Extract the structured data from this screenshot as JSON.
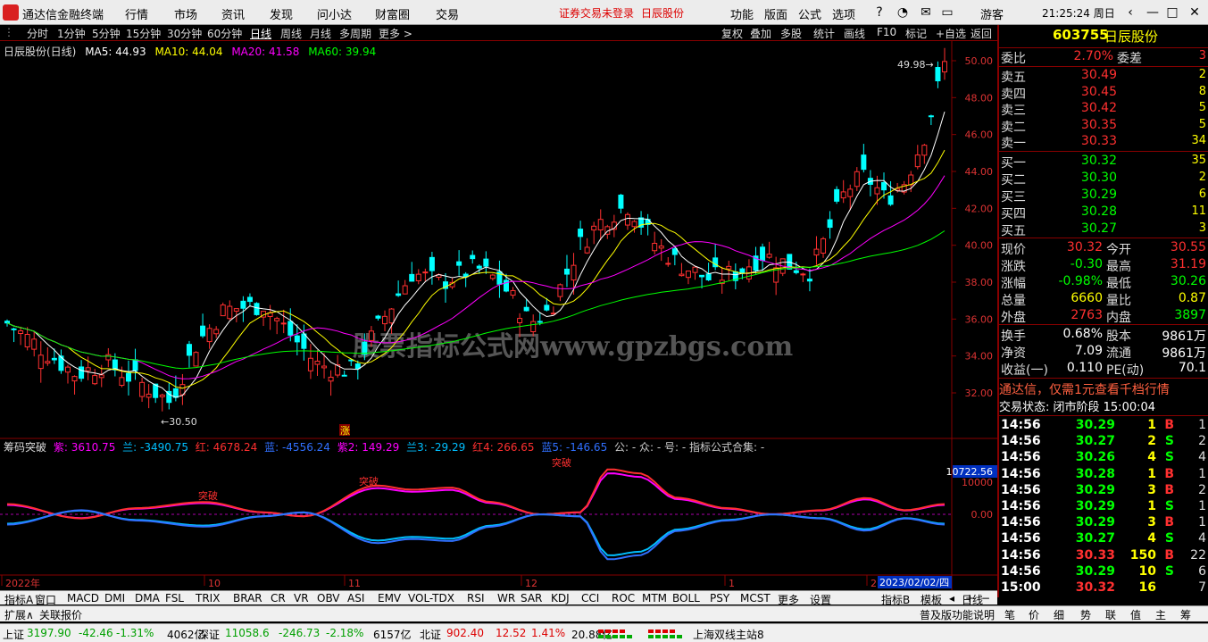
{
  "app": {
    "name": "通达信金融终端",
    "menu": [
      "行情",
      "市场",
      "资讯",
      "发现",
      "问小达",
      "财富圈",
      "交易"
    ],
    "notice": "证券交易未登录",
    "stock_title": "日辰股份",
    "right_menu": [
      "功能",
      "版面",
      "公式",
      "选项"
    ],
    "user": "游客",
    "time": "21:25:24 周日"
  },
  "periods": [
    "分时",
    "1分钟",
    "5分钟",
    "15分钟",
    "30分钟",
    "60分钟",
    "日线",
    "周线",
    "月线",
    "多周期",
    "更多 >"
  ],
  "right_buttons": [
    "复权",
    "叠加",
    "多股",
    "统计",
    "画线",
    "F10",
    "标记",
    "+自选",
    "返回"
  ],
  "chart_header": {
    "name": "日辰股份(日线)",
    "ma": [
      {
        "label": "MA5: 44.93",
        "color": "#ffffff"
      },
      {
        "label": "MA10: 44.04",
        "color": "#ffff00"
      },
      {
        "label": "MA20: 41.58",
        "color": "#ff00ff"
      },
      {
        "label": "MA60: 39.94",
        "color": "#00ff00"
      }
    ]
  },
  "ind_header": {
    "name": "筹码突破",
    "items": [
      {
        "label": "紫: 3610.75",
        "color": "#ff00ff"
      },
      {
        "label": "兰: -3490.75",
        "color": "#00bfff"
      },
      {
        "label": "红: 4678.24",
        "color": "#ff3030"
      },
      {
        "label": "蓝: -4556.24",
        "color": "#3070ff"
      },
      {
        "label": "紫2: 149.29",
        "color": "#ff00ff"
      },
      {
        "label": "兰3: -29.29",
        "color": "#00bfff"
      },
      {
        "label": "红4: 266.65",
        "color": "#ff3030"
      },
      {
        "label": "蓝5: -146.65",
        "color": "#3070ff"
      },
      {
        "label": "公: - 众: - 号: - 指标公式合集: -",
        "color": "#cccccc"
      }
    ]
  },
  "chart_data": {
    "type": "candlestick",
    "price_axis": [
      50.0,
      48.0,
      46.0,
      44.0,
      42.0,
      40.0,
      38.0,
      36.0,
      34.0,
      32.0
    ],
    "ylim": [
      30.0,
      51.0
    ],
    "max_label": "49.98",
    "min_label": "30.50",
    "watermark": "股票指标公式网www.gpzbgs.com",
    "zhang_label": "涨",
    "x_labels": [
      "2022年",
      "10",
      "11",
      "12",
      "1",
      "2"
    ],
    "date_label": "2023/02/02/四",
    "ind_axis": [
      "10722.56",
      "10000",
      "0.00"
    ],
    "ind_labels": [
      "突破",
      "突破",
      "突破"
    ]
  },
  "quote": {
    "code": "603755",
    "name": "日辰股份",
    "weibi": "2.70%",
    "weicha": "3",
    "sells": [
      {
        "l": "卖五",
        "p": "30.49",
        "v": "2"
      },
      {
        "l": "卖四",
        "p": "30.45",
        "v": "8"
      },
      {
        "l": "卖三",
        "p": "30.42",
        "v": "5"
      },
      {
        "l": "卖二",
        "p": "30.35",
        "v": "5"
      },
      {
        "l": "卖一",
        "p": "30.33",
        "v": "34"
      }
    ],
    "buys": [
      {
        "l": "买一",
        "p": "30.32",
        "v": "35"
      },
      {
        "l": "买二",
        "p": "30.30",
        "v": "2"
      },
      {
        "l": "买三",
        "p": "30.29",
        "v": "6"
      },
      {
        "l": "买四",
        "p": "30.28",
        "v": "11"
      },
      {
        "l": "买五",
        "p": "30.27",
        "v": "3"
      }
    ],
    "stats": [
      {
        "l": "现价",
        "v": "30.32",
        "c": "#ff3030",
        "l2": "今开",
        "v2": "30.55",
        "c2": "#ff3030"
      },
      {
        "l": "涨跌",
        "v": "-0.30",
        "c": "#00ff00",
        "l2": "最高",
        "v2": "31.19",
        "c2": "#ff3030"
      },
      {
        "l": "涨幅",
        "v": "-0.98%",
        "c": "#00ff00",
        "l2": "最低",
        "v2": "30.26",
        "c2": "#00ff00"
      },
      {
        "l": "总量",
        "v": "6660",
        "c": "#ffff00",
        "l2": "量比",
        "v2": "0.87",
        "c2": "#ffff00"
      },
      {
        "l": "外盘",
        "v": "2763",
        "c": "#ff3030",
        "l2": "内盘",
        "v2": "3897",
        "c2": "#00ff00"
      }
    ],
    "stats2": [
      {
        "l": "换手",
        "v": "0.68%",
        "l2": "股本",
        "v2": "9861万"
      },
      {
        "l": "净资",
        "v": "7.09",
        "l2": "流通",
        "v2": "9861万"
      },
      {
        "l": "收益(一)",
        "v": "0.110",
        "l2": "PE(动)",
        "v2": "70.1"
      }
    ],
    "promo": "通达信，仅需1元查看千档行情",
    "trade_state": "交易状态: 闭市阶段 15:00:04",
    "ticks": [
      {
        "t": "14:56",
        "p": "30.29",
        "v": "1",
        "d": "B",
        "n": "1"
      },
      {
        "t": "14:56",
        "p": "30.27",
        "v": "2",
        "d": "S",
        "n": "2"
      },
      {
        "t": "14:56",
        "p": "30.26",
        "v": "4",
        "d": "S",
        "n": "4"
      },
      {
        "t": "14:56",
        "p": "30.28",
        "v": "1",
        "d": "B",
        "n": "1"
      },
      {
        "t": "14:56",
        "p": "30.29",
        "v": "3",
        "d": "B",
        "n": "2"
      },
      {
        "t": "14:56",
        "p": "30.29",
        "v": "1",
        "d": "S",
        "n": "1"
      },
      {
        "t": "14:56",
        "p": "30.29",
        "v": "3",
        "d": "B",
        "n": "1"
      },
      {
        "t": "14:56",
        "p": "30.27",
        "v": "4",
        "d": "S",
        "n": "4"
      },
      {
        "t": "14:56",
        "p": "30.33",
        "v": "150",
        "d": "B",
        "n": "22"
      },
      {
        "t": "14:56",
        "p": "30.29",
        "v": "10",
        "d": "S",
        "n": "6"
      },
      {
        "t": "15:00",
        "p": "30.32",
        "v": "16",
        "d": "",
        "n": "7"
      }
    ]
  },
  "tabs": [
    "指标A",
    "窗口",
    "MACD",
    "DMI",
    "DMA",
    "FSL",
    "TRIX",
    "BRAR",
    "CR",
    "VR",
    "OBV",
    "ASI",
    "EMV",
    "VOL-TDX",
    "RSI",
    "WR",
    "SAR",
    "KDJ",
    "CCI",
    "ROC",
    "MTM",
    "BOLL",
    "PSY",
    "MCST",
    "更多",
    "设置"
  ],
  "tabs_right": [
    "指标B",
    "模板",
    "日线"
  ],
  "row2": [
    "扩展∧",
    "关联报价"
  ],
  "row2_right": [
    "普及版功能说明",
    "笔",
    "价",
    "细",
    "势",
    "联",
    "值",
    "主",
    "筹"
  ],
  "status": {
    "sh_label": "上证",
    "sh": "3197.90",
    "sh_chg": "-42.46",
    "sh_pct": "-1.31%",
    "sh_amt": "4062亿",
    "sz_label": "深证",
    "sz": "11058.6",
    "sz_chg": "-246.73",
    "sz_pct": "-2.18%",
    "sz_amt": "6157亿",
    "bz_label": "北证",
    "bz": "902.40",
    "bz_chg": "12.52",
    "bz_pct": "1.41%",
    "bz_amt": "20.88亿",
    "site": "上海双线主站8"
  }
}
